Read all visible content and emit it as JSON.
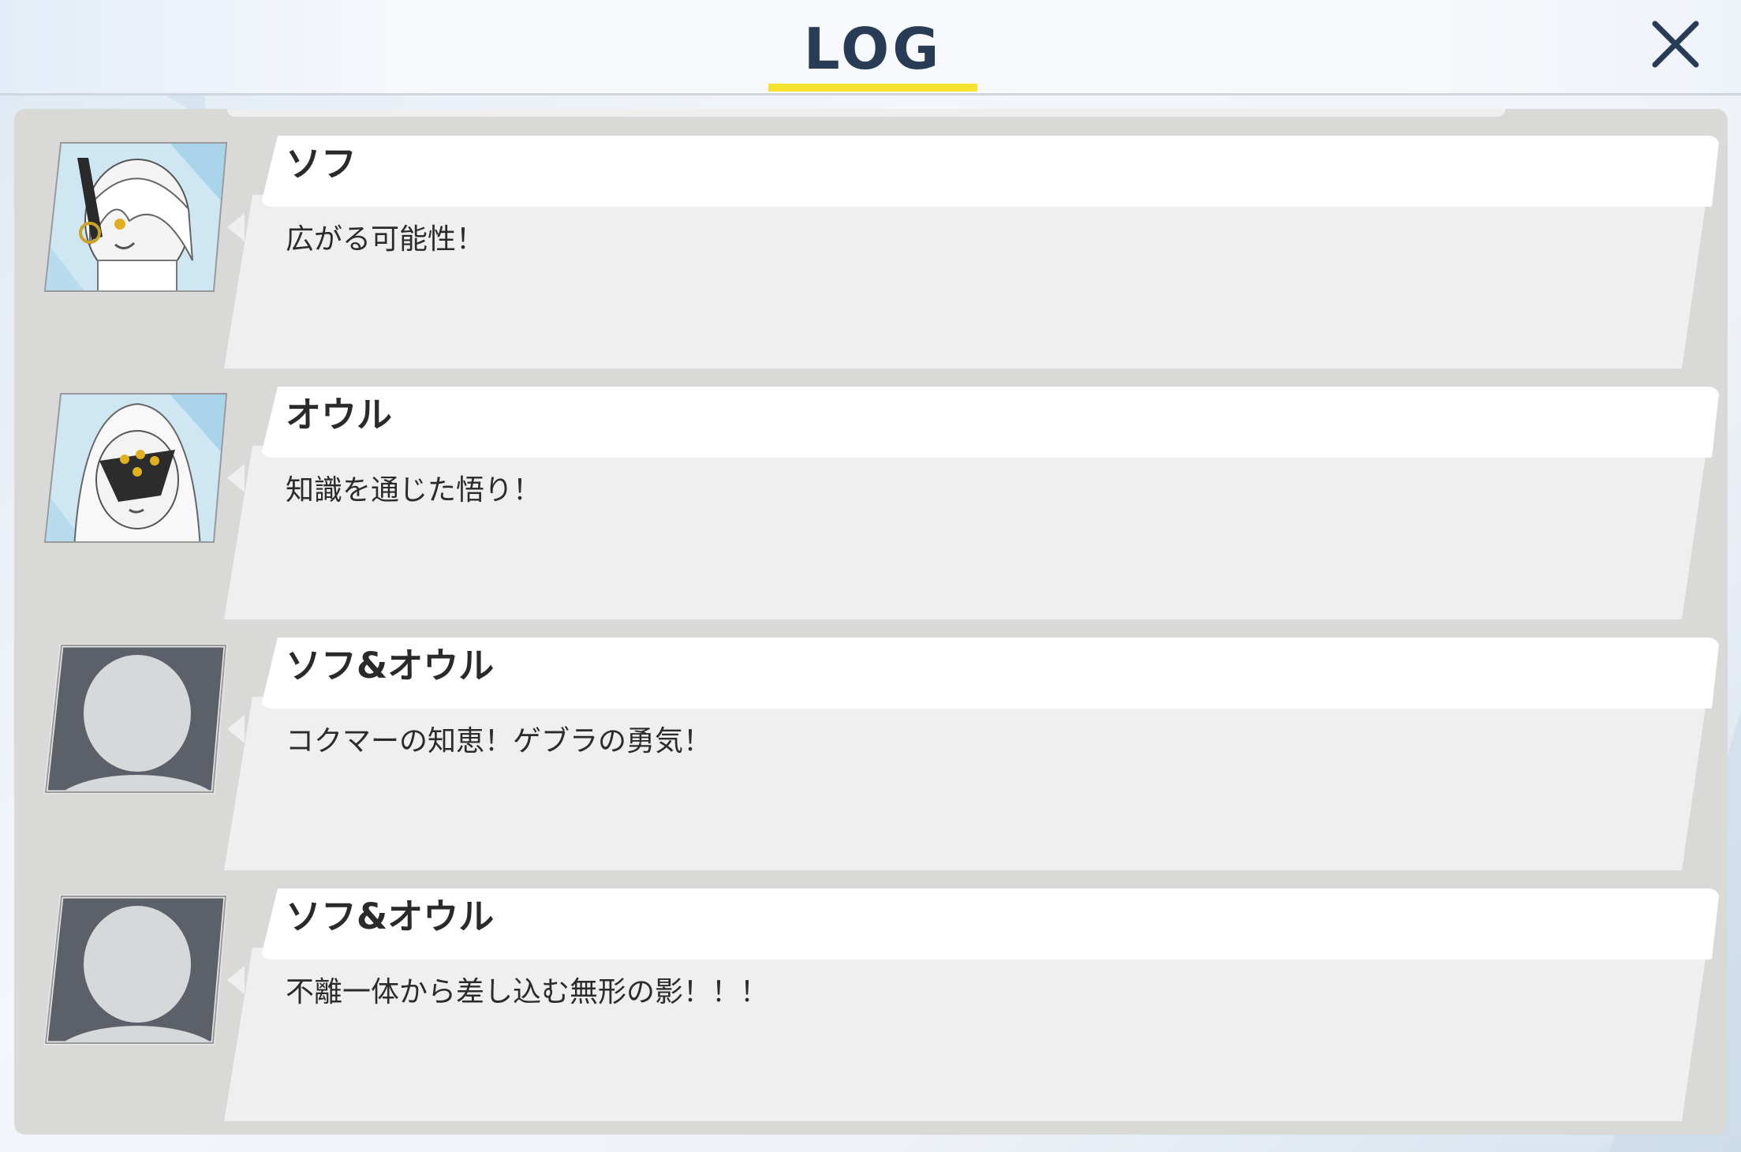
{
  "header": {
    "title": "LOG",
    "accent_color": "#f4e431",
    "title_color": "#283d55"
  },
  "close": {
    "icon": "close-icon"
  },
  "entries": [
    {
      "speaker": "ソフ",
      "text": "広がる可能性！",
      "avatar": "sof-portrait"
    },
    {
      "speaker": "オウル",
      "text": "知識を通じた悟り！",
      "avatar": "owl-portrait"
    },
    {
      "speaker": "ソフ&オウル",
      "text": "コクマーの知恵！ゲブラの勇気！",
      "avatar": "silhouette-placeholder"
    },
    {
      "speaker": "ソフ&オウル",
      "text": "不離一体から差し込む無形の影！！！",
      "avatar": "silhouette-placeholder"
    }
  ]
}
